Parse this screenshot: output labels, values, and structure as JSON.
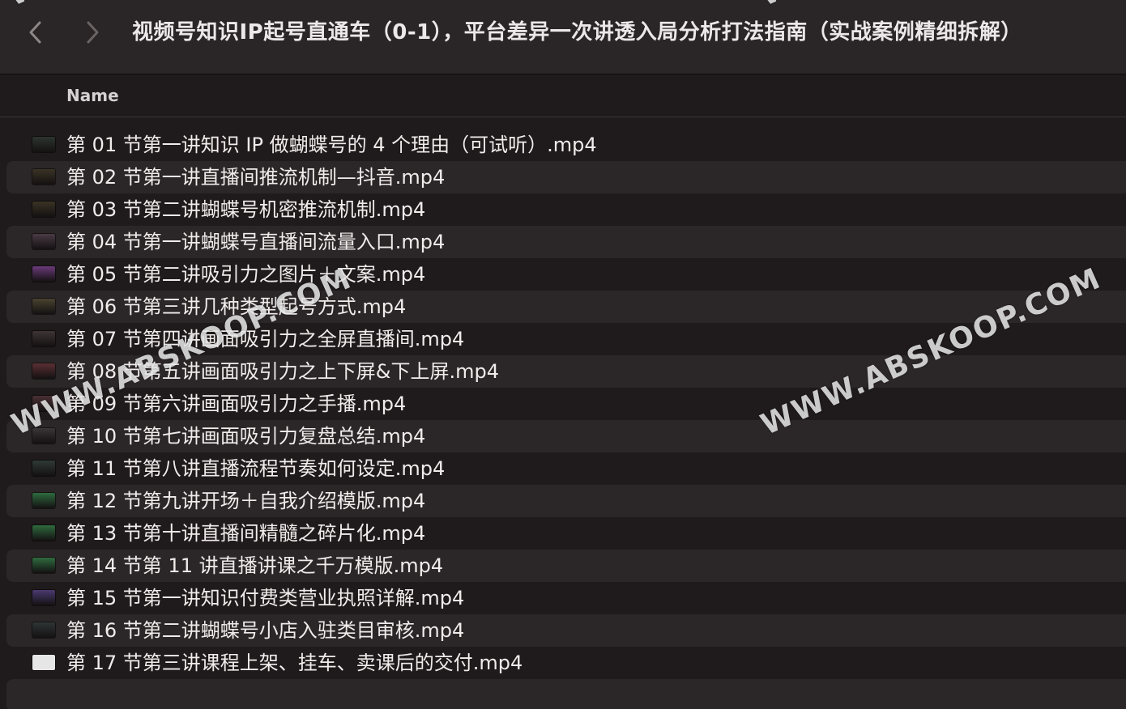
{
  "window": {
    "title": "视频号知识IP起号直通车（0-1），平台差异一次讲透入局分析打法指南（实战案例精细拆解）"
  },
  "toolbar": {
    "back_icon": "chevron-left-icon",
    "forward_icon": "chevron-right-icon"
  },
  "list_header": {
    "name_label": "Name"
  },
  "watermark": {
    "text": "WWW.ABSKOOP.COM",
    "top_text_left": "WW",
    "top_text_right": "WW"
  },
  "colors": {
    "background": "#1f1a1b",
    "alt_row": "#2b2627",
    "toolbar": "#2a2526",
    "text": "#f0ecec"
  },
  "files": [
    {
      "name": "第 01 节第一讲知识 IP 做蝴蝶号的 4 个理由（可试听）.mp4",
      "thumb": "#2d3530"
    },
    {
      "name": "第 02 节第一讲直播间推流机制—抖音.mp4",
      "thumb": "#3a3325"
    },
    {
      "name": "第 03 节第二讲蝴蝶号机密推流机制.mp4",
      "thumb": "#3a3325"
    },
    {
      "name": "第 04 节第一讲蝴蝶号直播间流量入口.mp4",
      "thumb": "#4a3a44"
    },
    {
      "name": "第 05 节第二讲吸引力之图片＋文案.mp4",
      "thumb": "#6b3a7a"
    },
    {
      "name": "第 06 节第三讲几种类型起号方式.mp4",
      "thumb": "#4a4330"
    },
    {
      "name": "第 07 节第四讲画面吸引力之全屏直播间.mp4",
      "thumb": "#3f3536"
    },
    {
      "name": "第 08 节第五讲画面吸引力之上下屏&下上屏.mp4",
      "thumb": "#5a2f33"
    },
    {
      "name": "第 09 节第六讲画面吸引力之手播.mp4",
      "thumb": "#4a3035"
    },
    {
      "name": "第 10 节第七讲画面吸引力复盘总结.mp4",
      "thumb": "#3a3536"
    },
    {
      "name": "第 11 节第八讲直播流程节奏如何设定.mp4",
      "thumb": "#2f3a36"
    },
    {
      "name": "第 12 节第九讲开场＋自我介绍模版.mp4",
      "thumb": "#2f6b3e"
    },
    {
      "name": "第 13 节第十讲直播间精髓之碎片化.mp4",
      "thumb": "#2f6b3e"
    },
    {
      "name": "第 14 节第 11 讲直播讲课之千万模版.mp4",
      "thumb": "#2f6b3e"
    },
    {
      "name": "第 15 节第一讲知识付费类营业执照详解.mp4",
      "thumb": "#4a3a70"
    },
    {
      "name": "第 16 节第二讲蝴蝶号小店入驻类目审核.mp4",
      "thumb": "#2f3536"
    },
    {
      "name": "第 17 节第三讲课程上架、挂车、卖课后的交付.mp4",
      "thumb": "#e6e6e6"
    }
  ]
}
